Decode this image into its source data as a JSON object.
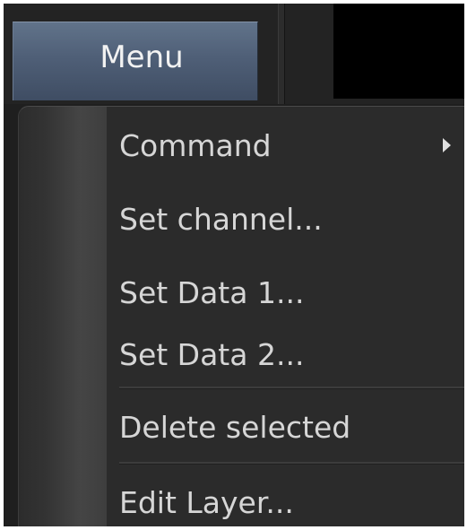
{
  "toolbar": {
    "menu_button_label": "Menu"
  },
  "menu": {
    "items": [
      {
        "label": "Command",
        "has_submenu": true
      },
      {
        "label": "Set channel..."
      },
      {
        "label": "Set Data 1..."
      },
      {
        "label": "Set Data 2..."
      },
      {
        "label": "Delete selected"
      },
      {
        "label": "Edit Layer..."
      }
    ]
  },
  "icons": {
    "submenu": "chevron-right-icon"
  },
  "colors": {
    "menu_button": "#4f5f77",
    "menu_background": "#2b2b2b",
    "menu_text": "#d6d6d6"
  }
}
